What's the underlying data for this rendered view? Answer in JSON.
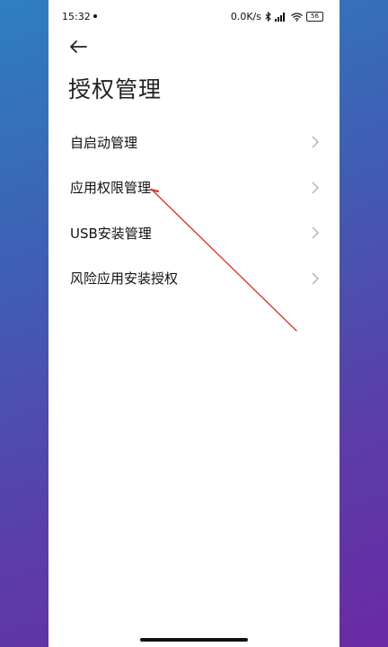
{
  "status_bar": {
    "time": "15:32",
    "network_speed": "0.0K/s",
    "battery": "56"
  },
  "header": {
    "back_icon": "arrow-left-icon",
    "title": "授权管理"
  },
  "menu": {
    "items": [
      {
        "label": "自启动管理",
        "icon": "chevron-right-icon"
      },
      {
        "label": "应用权限管理",
        "icon": "chevron-right-icon"
      },
      {
        "label": "USB安装管理",
        "icon": "chevron-right-icon"
      },
      {
        "label": "风险应用安装授权",
        "icon": "chevron-right-icon"
      }
    ]
  },
  "colors": {
    "annotation": "#d23a2f",
    "text": "#111111",
    "chevron": "#b5b5b5"
  }
}
